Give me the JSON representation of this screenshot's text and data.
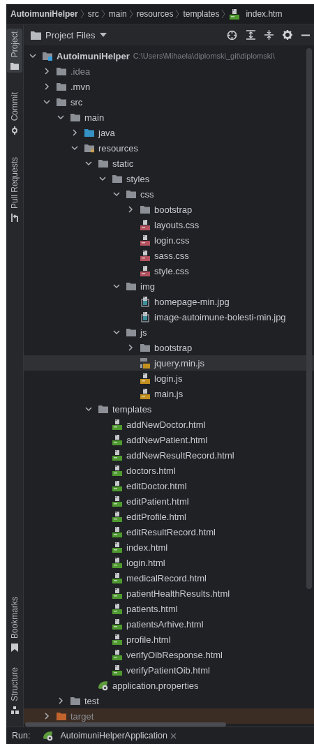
{
  "breadcrumb": [
    {
      "label": "AutoimuniHelper",
      "kind": "project"
    },
    {
      "label": "src",
      "kind": "folder"
    },
    {
      "label": "main",
      "kind": "folder"
    },
    {
      "label": "resources",
      "kind": "folder"
    },
    {
      "label": "templates",
      "kind": "folder"
    },
    {
      "label": "index.htm",
      "kind": "html"
    }
  ],
  "tool_strip": {
    "top": [
      {
        "label": "Project",
        "kind": "folder",
        "selected": true
      },
      {
        "label": "Commit",
        "kind": "commit",
        "selected": false
      },
      {
        "label": "Pull Requests",
        "kind": "pull",
        "selected": false
      }
    ],
    "bottom": [
      {
        "label": "Bookmarks",
        "kind": "bookmark",
        "selected": false
      },
      {
        "label": "Structure",
        "kind": "structure",
        "selected": false
      }
    ]
  },
  "panel": {
    "title": "Project Files"
  },
  "tree": [
    {
      "name": "AutoimuniHelper",
      "kind": "module",
      "path": "C:\\Users\\Mihaela\\diplomski_git\\diplomski\\",
      "expanded": true,
      "selected": false,
      "children": [
        {
          "name": ".idea",
          "kind": "ignored-folder",
          "expanded": false,
          "selected": false
        },
        {
          "name": ".mvn",
          "kind": "folder",
          "expanded": false,
          "selected": false
        },
        {
          "name": "src",
          "kind": "folder",
          "expanded": true,
          "selected": false,
          "children": [
            {
              "name": "main",
              "kind": "folder",
              "expanded": true,
              "selected": false,
              "children": [
                {
                  "name": "java",
                  "kind": "source-folder",
                  "expanded": false,
                  "selected": false
                },
                {
                  "name": "resources",
                  "kind": "resources-folder",
                  "expanded": true,
                  "selected": false,
                  "children": [
                    {
                      "name": "static",
                      "kind": "folder",
                      "expanded": true,
                      "selected": false,
                      "children": [
                        {
                          "name": "styles",
                          "kind": "folder",
                          "expanded": true,
                          "selected": false,
                          "children": [
                            {
                              "name": "css",
                              "kind": "folder",
                              "expanded": true,
                              "selected": false,
                              "children": [
                                {
                                  "name": "bootstrap",
                                  "kind": "folder",
                                  "expanded": false,
                                  "selected": false
                                },
                                {
                                  "name": "layouts.css",
                                  "kind": "css",
                                  "selected": false
                                },
                                {
                                  "name": "login.css",
                                  "kind": "css",
                                  "selected": false
                                },
                                {
                                  "name": "sass.css",
                                  "kind": "css",
                                  "selected": false
                                },
                                {
                                  "name": "style.css",
                                  "kind": "css",
                                  "selected": false
                                }
                              ]
                            },
                            {
                              "name": "img",
                              "kind": "folder",
                              "expanded": true,
                              "selected": false,
                              "children": [
                                {
                                  "name": "homepage-min.jpg",
                                  "kind": "image",
                                  "selected": false
                                },
                                {
                                  "name": "image-autoimune-bolesti-min.jpg",
                                  "kind": "image",
                                  "selected": false
                                }
                              ]
                            },
                            {
                              "name": "js",
                              "kind": "folder",
                              "expanded": true,
                              "selected": false,
                              "children": [
                                {
                                  "name": "bootstrap",
                                  "kind": "folder",
                                  "expanded": false,
                                  "selected": false
                                },
                                {
                                  "name": "jquery.min.js",
                                  "kind": "binary-js",
                                  "selected": true
                                },
                                {
                                  "name": "login.js",
                                  "kind": "js",
                                  "selected": false
                                },
                                {
                                  "name": "main.js",
                                  "kind": "js",
                                  "selected": false
                                }
                              ]
                            }
                          ]
                        }
                      ]
                    },
                    {
                      "name": "templates",
                      "kind": "folder",
                      "expanded": true,
                      "selected": false,
                      "children": [
                        {
                          "name": "addNewDoctor.html",
                          "kind": "html",
                          "selected": false
                        },
                        {
                          "name": "addNewPatient.html",
                          "kind": "html",
                          "selected": false
                        },
                        {
                          "name": "addNewResultRecord.html",
                          "kind": "html",
                          "selected": false
                        },
                        {
                          "name": "doctors.html",
                          "kind": "html",
                          "selected": false
                        },
                        {
                          "name": "editDoctor.html",
                          "kind": "html",
                          "selected": false
                        },
                        {
                          "name": "editPatient.html",
                          "kind": "html",
                          "selected": false
                        },
                        {
                          "name": "editProfile.html",
                          "kind": "html",
                          "selected": false
                        },
                        {
                          "name": "editResultRecord.html",
                          "kind": "html",
                          "selected": false
                        },
                        {
                          "name": "index.html",
                          "kind": "html",
                          "selected": false
                        },
                        {
                          "name": "login.html",
                          "kind": "html",
                          "selected": false
                        },
                        {
                          "name": "medicalRecord.html",
                          "kind": "html",
                          "selected": false
                        },
                        {
                          "name": "patientHealthResults.html",
                          "kind": "html",
                          "selected": false
                        },
                        {
                          "name": "patients.html",
                          "kind": "html",
                          "selected": false
                        },
                        {
                          "name": "patientsArhive.html",
                          "kind": "html",
                          "selected": false
                        },
                        {
                          "name": "profile.html",
                          "kind": "html",
                          "selected": false
                        },
                        {
                          "name": "verifyOibResponse.html",
                          "kind": "html",
                          "selected": false
                        },
                        {
                          "name": "verifyPatientOib.html",
                          "kind": "html",
                          "selected": false
                        }
                      ]
                    },
                    {
                      "name": "application.properties",
                      "kind": "spring",
                      "selected": false
                    }
                  ]
                }
              ]
            },
            {
              "name": "test",
              "kind": "folder",
              "expanded": false,
              "selected": false
            }
          ]
        },
        {
          "name": "target",
          "kind": "excluded-folder",
          "expanded": false,
          "selected": false
        }
      ]
    }
  ],
  "run_bar": {
    "label": "Run:",
    "tab": "AutoimuniHelperApplication"
  }
}
